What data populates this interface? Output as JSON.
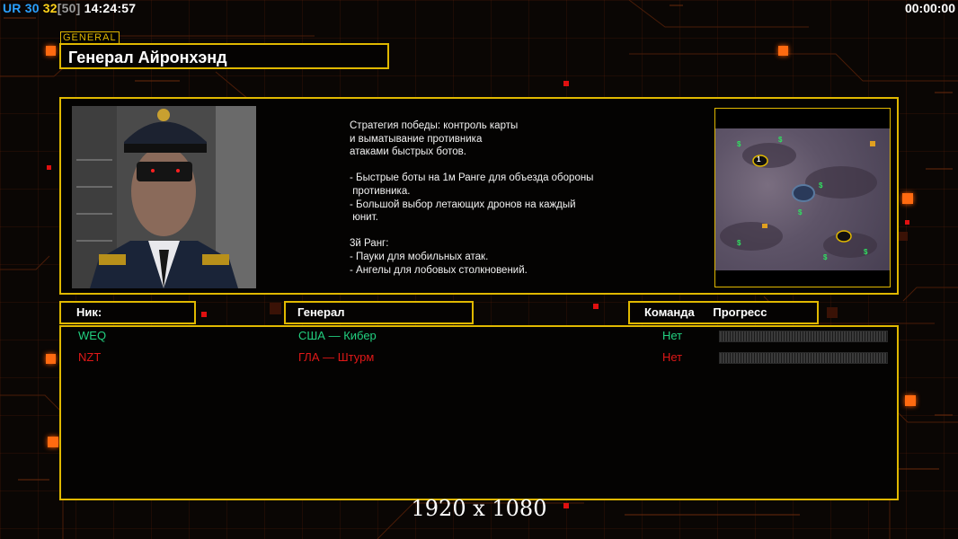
{
  "hud": {
    "ur_label": "UR",
    "ur_value": "30",
    "fps": "32",
    "fps_cap": "[50]",
    "clock": "14:24:57",
    "game_timer": "00:00:00"
  },
  "general": {
    "tag": "GENERAL",
    "name": "Генерал Айронхэнд",
    "description": "Стратегия победы: контроль карты\nи выматывание противника\nатаками быстрых ботов.\n\n- Быстрые боты на 1м Ранге для объезда обороны\n противника.\n- Большой выбор летающих дронов на каждый\n юнит.\n\n3й Ранг:\n- Пауки для мобильных атак.\n- Ангелы для лобовых столкновений."
  },
  "minimap": {
    "player_start_label": "1"
  },
  "table": {
    "headers": {
      "nick": "Ник:",
      "general": "Генерал",
      "team": "Команда",
      "progress": "Прогресс"
    },
    "rows": [
      {
        "nick": "WEQ",
        "general": "США — Кибер",
        "team": "Нет",
        "color": "#22d080",
        "progress": 0
      },
      {
        "nick": "NZT",
        "general": "ГЛА — Штурм",
        "team": "Нет",
        "color": "#e01818",
        "progress": 0
      }
    ]
  },
  "resolution_label": "1920 x 1080",
  "colors": {
    "accent": "#e0b800",
    "highlight": "#ff6a10"
  }
}
